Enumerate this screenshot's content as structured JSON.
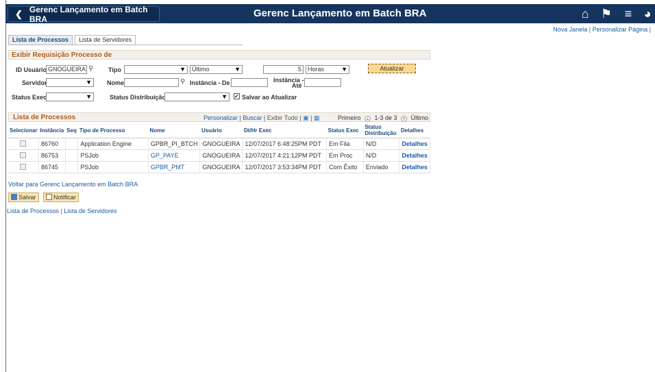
{
  "header": {
    "back_label": "Gerenc Lançamento em Batch BRA",
    "title": "Gerenc Lançamento em Batch BRA"
  },
  "top_links": {
    "new_window": "Nova Janela",
    "personalize": "Personalizar Página"
  },
  "tabs": [
    {
      "label": "Lista de Processos",
      "active": true
    },
    {
      "label": "Lista de Servidores",
      "active": false
    }
  ],
  "filter": {
    "section_title": "Exibir Requisição Processo de",
    "user_id_label": "ID Usuário",
    "user_id_value": "GNOGUEIRA",
    "tipo_label": "Tipo",
    "tipo_value": "",
    "period_value": "Último",
    "count_value": "5",
    "unit_value": "Horas",
    "refresh_label": "Atualizar",
    "servidor_label": "Servidor",
    "servidor_value": "",
    "nome_label": "Nome",
    "nome_value": "",
    "instancia_de_label": "Instância - De",
    "instancia_de_value": "",
    "instancia_ate_label": "Instância -",
    "instancia_ate_label2": "Até",
    "instancia_ate_value": "",
    "status_exec_label": "Status Exec",
    "status_exec_value": "",
    "status_dist_label": "Status Distribuição",
    "status_dist_value": "",
    "save_on_refresh_label": "Salvar ao Atualizar",
    "save_on_refresh_checked": true
  },
  "grid": {
    "title": "Lista de Processos",
    "tools": {
      "personalize": "Personalizar",
      "find": "Buscar",
      "view_all": "Exibir Tudo"
    },
    "nav": {
      "first": "Primeiro",
      "range": "1-3 de 3",
      "last": "Último"
    },
    "columns": [
      "Selecionar",
      "Instância",
      "Seq",
      "Tipo de Processo",
      "Nome",
      "Usuário",
      "Dt/Hr Exec",
      "Status Exec",
      "Status Distribuição",
      "Detalhes"
    ],
    "rows": [
      {
        "instancia": "86760",
        "seq": "",
        "tipo": "Application Engine",
        "nome": "GPBR_PI_BTCH",
        "usuario": "GNOGUEIRA",
        "dthr": "12/07/2017  6:48:25PM PDT",
        "status": "Em Fila",
        "dist": "N/D",
        "det": "Detalhes"
      },
      {
        "instancia": "86753",
        "seq": "",
        "tipo": "PSJob",
        "nome": "GP_PAYE",
        "usuario": "GNOGUEIRA",
        "dthr": "12/07/2017  4:21:12PM PDT",
        "status": "Em Proc",
        "dist": "N/D",
        "det": "Detalhes"
      },
      {
        "instancia": "86745",
        "seq": "",
        "tipo": "PSJob",
        "nome": "GPBR_PMT",
        "usuario": "GNOGUEIRA",
        "dthr": "12/07/2017  3:53:34PM PDT",
        "status": "Com Êxito",
        "dist": "Enviado",
        "det": "Detalhes"
      }
    ]
  },
  "footer": {
    "back_link": "Voltar para Gerenc Lançamento em Batch BRA",
    "save_label": "Salvar",
    "notify_label": "Notificar",
    "link_processos": "Lista de Processos",
    "link_servidores": "Lista de Servidores"
  }
}
